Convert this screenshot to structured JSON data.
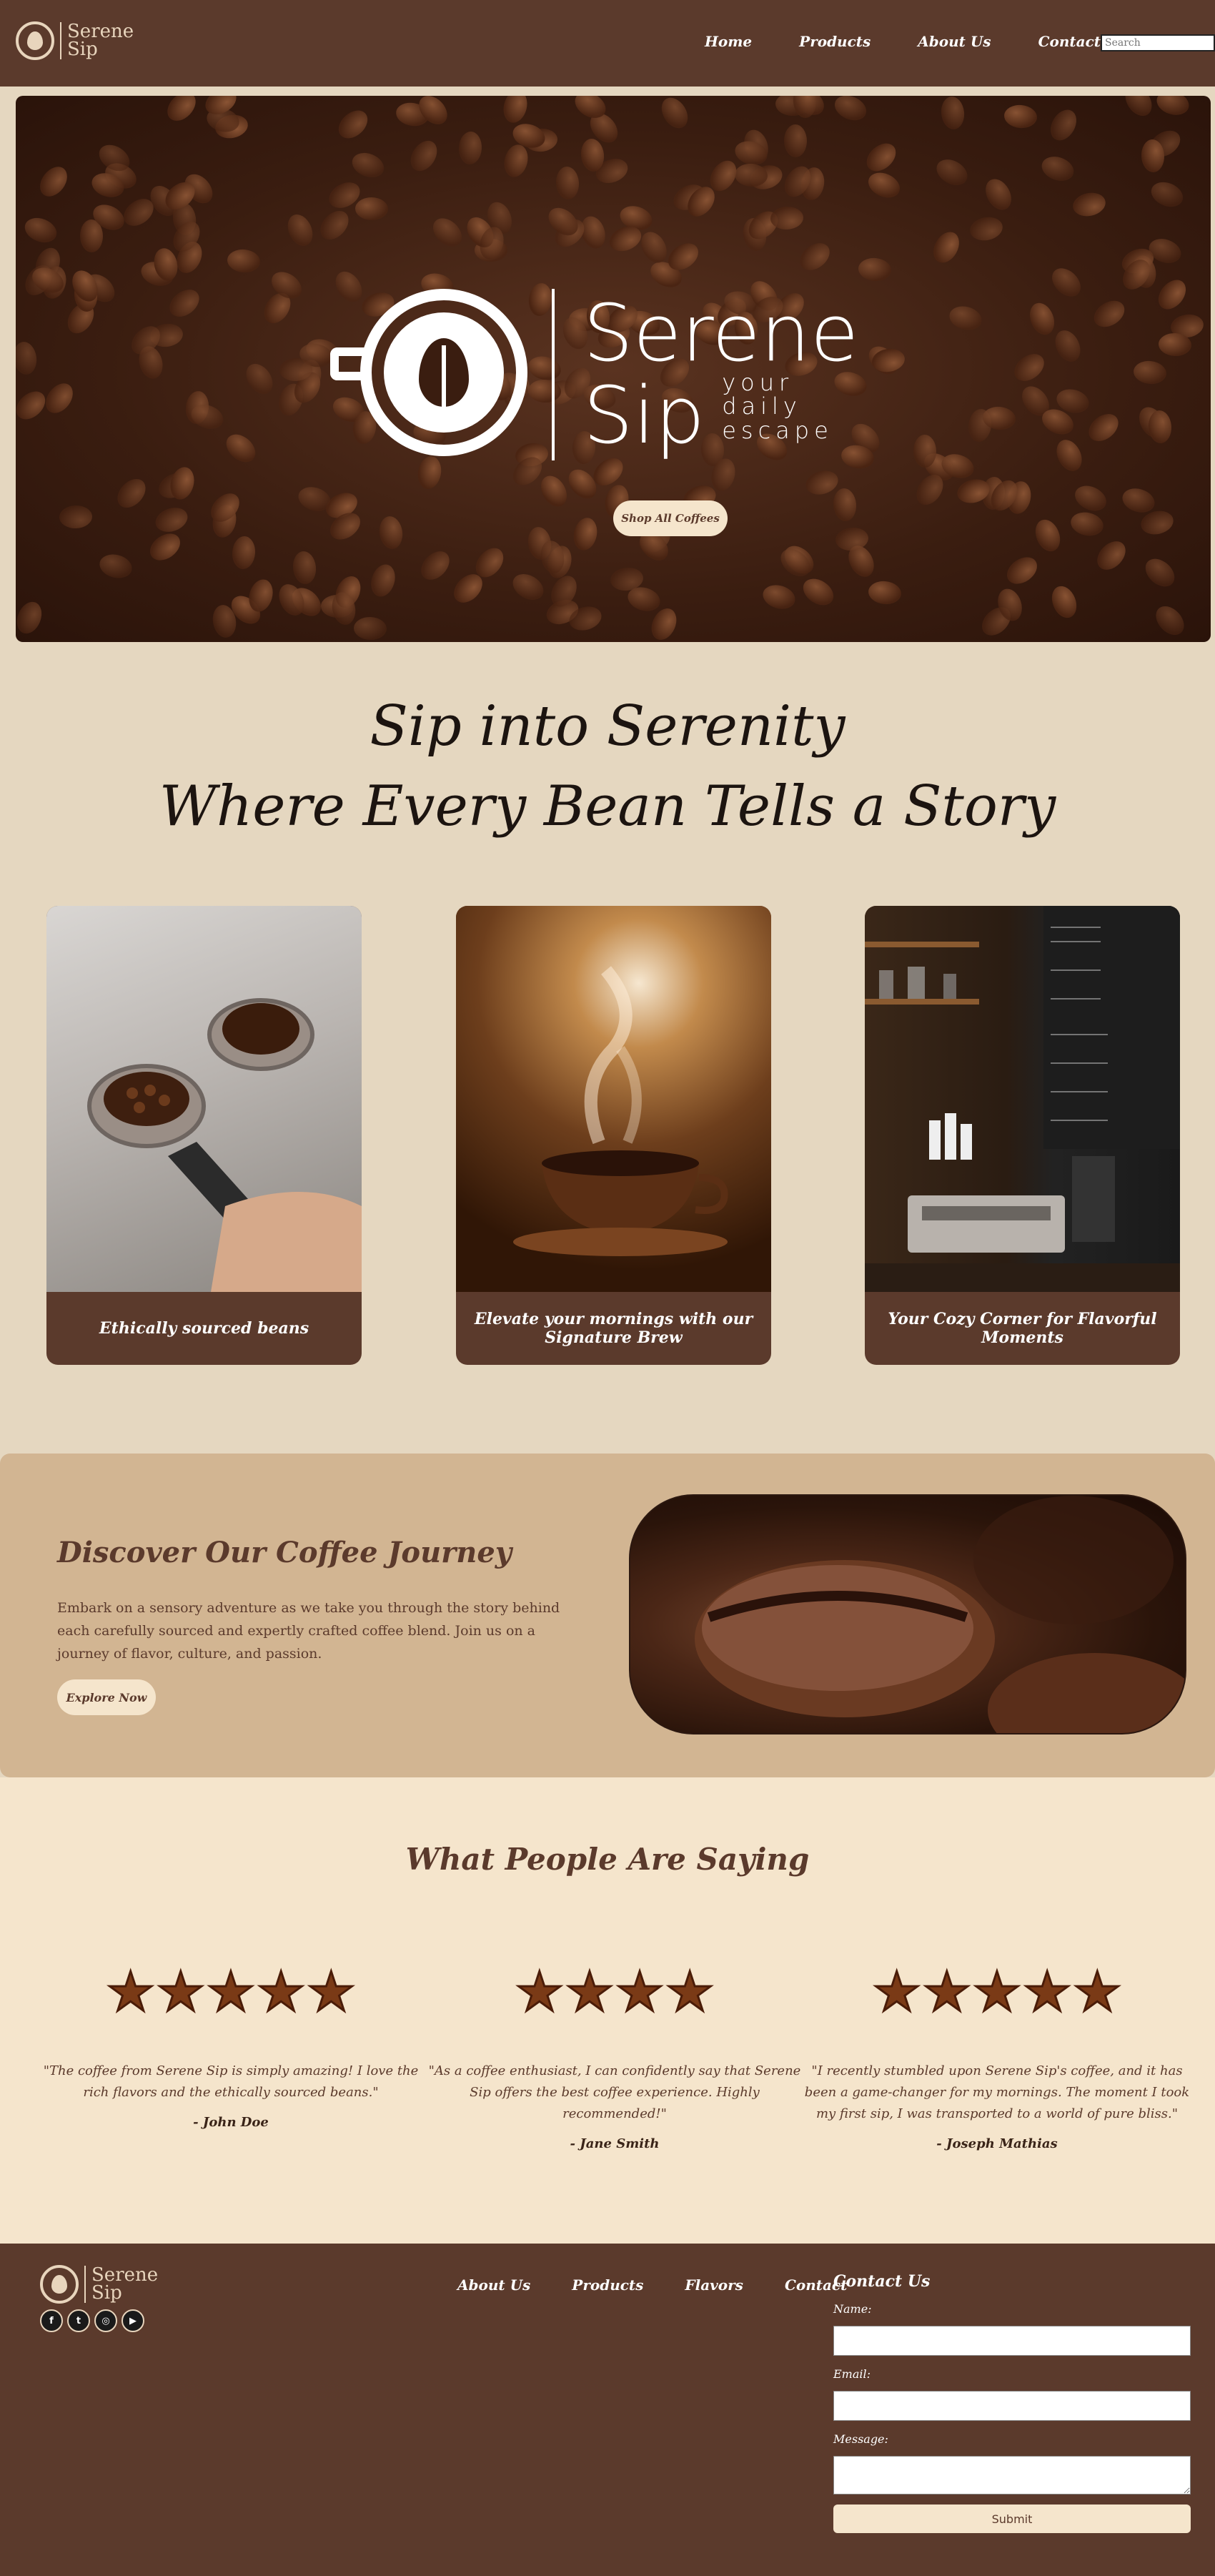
{
  "brand": {
    "name_line1": "Serene",
    "name_line2": "Sip",
    "tagline_words": [
      "your",
      "daily",
      "escape"
    ]
  },
  "header": {
    "nav": [
      "Home",
      "Products",
      "About Us",
      "Contact"
    ],
    "search_placeholder": "Search"
  },
  "hero": {
    "button_label": "Shop All Coffees"
  },
  "tagline": {
    "line1": "Sip into Serenity",
    "line2": "Where Every Bean Tells a Story"
  },
  "features": [
    {
      "caption": "Ethically sourced beans",
      "image": "espresso-portafilters-with-beans"
    },
    {
      "caption": "Elevate your mornings with our Signature Brew",
      "image": "steaming-coffee-cup"
    },
    {
      "caption": "Your Cozy Corner for Flavorful Moments",
      "image": "cafe-counter-with-menu-board"
    }
  ],
  "journey": {
    "title": "Discover Our Coffee Journey",
    "text": "Embark on a sensory adventure as we take you through the story behind each carefully sourced and expertly crafted coffee blend. Join us on a journey of flavor, culture, and passion.",
    "button_label": "Explore Now",
    "image": "coffee-bean-closeup"
  },
  "testimonials": {
    "title": "What People Are Saying",
    "items": [
      {
        "rating": 5,
        "quote": "\"The coffee from Serene Sip is simply amazing! I love the rich flavors and the ethically sourced beans.\"",
        "author": "- John Doe"
      },
      {
        "rating": 4,
        "quote": "\"As a coffee enthusiast, I can confidently say that Serene Sip offers the best coffee experience. Highly recommended!\"",
        "author": "- Jane Smith"
      },
      {
        "rating": 5,
        "quote": "\"I recently stumbled upon Serene Sip's coffee, and it has been a game-changer for my mornings. The moment I took my first sip, I was transported to a world of pure bliss.\"",
        "author": "- Joseph Mathias"
      }
    ]
  },
  "footer": {
    "socials": [
      "facebook-icon",
      "twitter-icon",
      "instagram-icon",
      "youtube-icon"
    ],
    "nav": [
      "About Us",
      "Products",
      "Flavors",
      "Contact"
    ],
    "contact": {
      "title": "Contact Us",
      "name_label": "Name:",
      "email_label": "Email:",
      "message_label": "Message:",
      "submit_label": "Submit"
    }
  },
  "colors": {
    "primary_brown": "#5b3a2c",
    "cream": "#f5e5cc",
    "tan": "#d2b592",
    "beige": "#e5d7c0"
  }
}
